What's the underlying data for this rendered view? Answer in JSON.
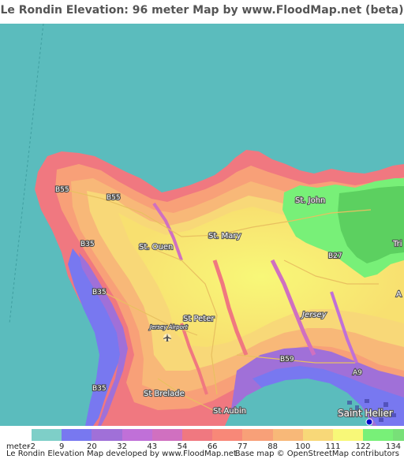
{
  "title": "Le Rondin Elevation: 96 meter Map by www.FloodMap.net (beta)",
  "map": {
    "sea_color": "#5bbcbd",
    "place_labels": {
      "st_ouen": "St. Ouen",
      "st_mary": "St. Mary",
      "st_john": "St. John",
      "st_peter": "St Peter",
      "jersey_airport": "Jersey Airport",
      "st_brelade": "St Brelade",
      "st_aubin": "St Aubin",
      "saint_helier": "Saint Helier",
      "jersey": "Jersey",
      "tri_partial": "Tri",
      "a_partial": "A"
    },
    "road_labels": {
      "b55_west": "B55",
      "b55_center": "B55",
      "b35_north": "B35",
      "b35_mid": "B35",
      "b35_south": "B35",
      "b27": "B27",
      "b59": "B59",
      "a9": "A9"
    },
    "icons": [
      "airport-icon",
      "location-marker-icon"
    ]
  },
  "legend": {
    "unit": "meter",
    "entries": [
      {
        "label": "-2",
        "color": "#7ecfc8"
      },
      {
        "label": "9",
        "color": "#7878f0"
      },
      {
        "label": "20",
        "color": "#a070d8"
      },
      {
        "label": "32",
        "color": "#c070d8"
      },
      {
        "label": "43",
        "color": "#d070c0"
      },
      {
        "label": "54",
        "color": "#f07880"
      },
      {
        "label": "66",
        "color": "#f88878"
      },
      {
        "label": "77",
        "color": "#f8a078"
      },
      {
        "label": "88",
        "color": "#f8b878"
      },
      {
        "label": "100",
        "color": "#f8d878"
      },
      {
        "label": "111",
        "color": "#f8f878"
      },
      {
        "label": "122",
        "color": "#78f078"
      },
      {
        "label": "134",
        "color": "#78e078"
      }
    ]
  },
  "credits": {
    "left": "Le Rondin Elevation Map developed by www.FloodMap.net",
    "right": "Base map © OpenStreetMap contributors"
  }
}
